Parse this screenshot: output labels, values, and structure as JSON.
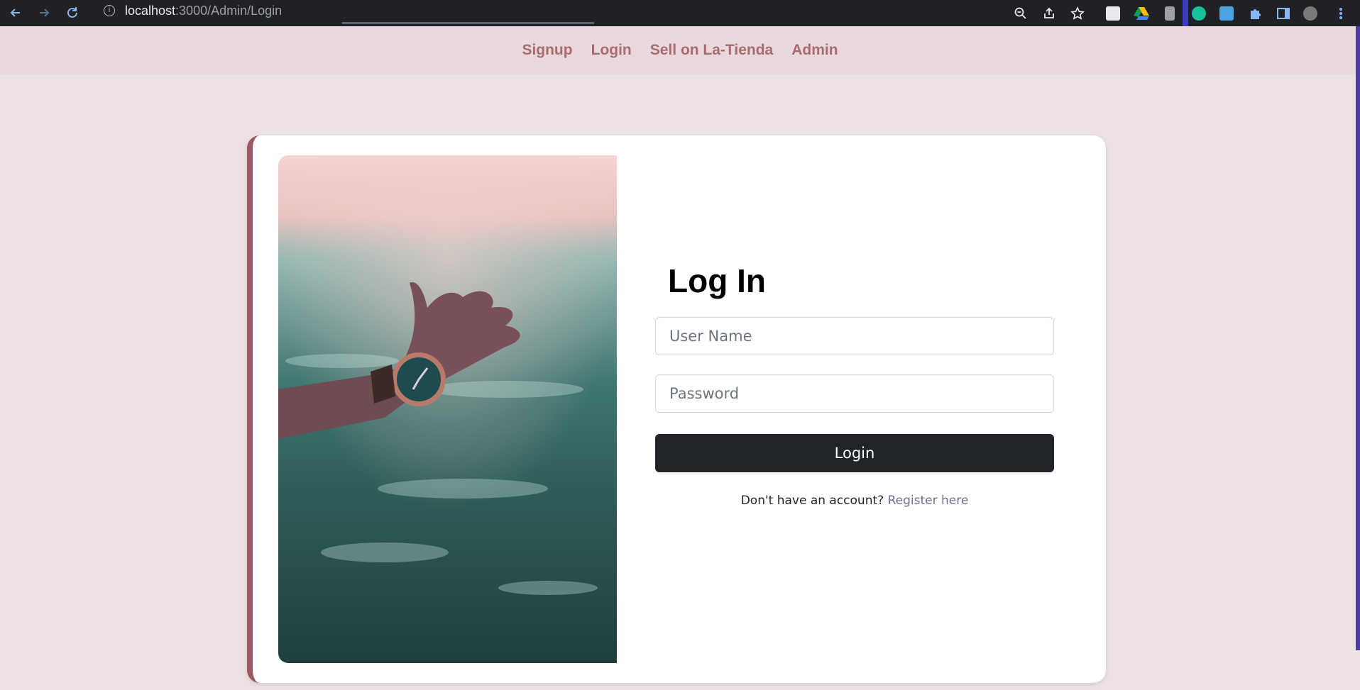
{
  "browser": {
    "url_host": "localhost",
    "url_path": ":3000/Admin/Login"
  },
  "navbar": {
    "links": [
      "Signup",
      "Login",
      "Sell on La-Tienda",
      "Admin"
    ]
  },
  "login_form": {
    "title": "Log In",
    "username_placeholder": "User Name",
    "password_placeholder": "Password",
    "submit_label": "Login",
    "register_prompt": "Don't have an account?",
    "register_link": "Register here"
  },
  "colors": {
    "page_bg": "#ede1e3",
    "navbar_bg": "#ead9dc",
    "nav_link": "#a96b6f",
    "card_accent": "#9d5963",
    "button_bg": "#212529"
  },
  "image": {
    "alt": "hand with wristwatch in water"
  }
}
